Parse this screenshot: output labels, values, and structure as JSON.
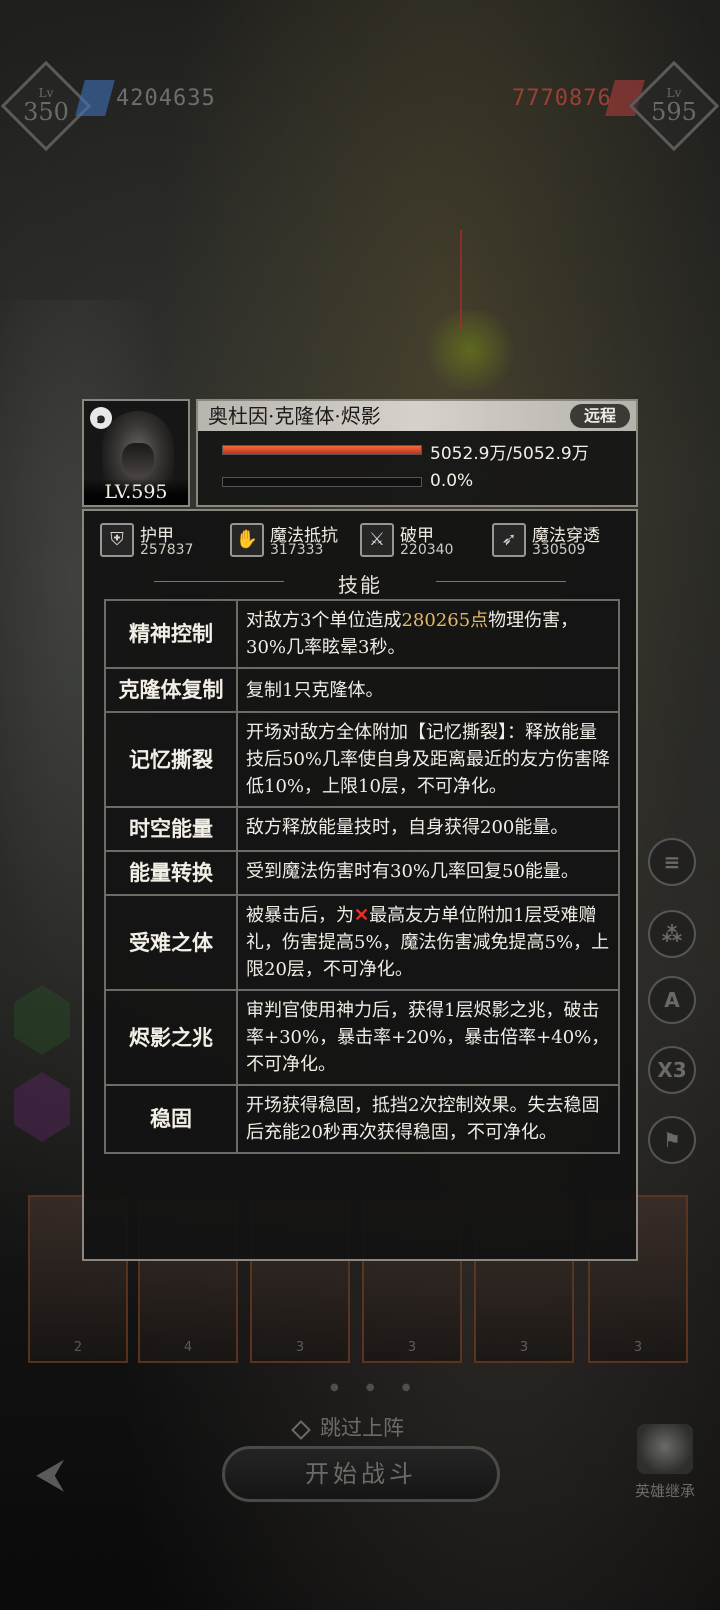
{
  "hud": {
    "left_level_tag": "Lv",
    "left_level": "350",
    "left_power": "4204635",
    "right_power": "7770876",
    "right_level_tag": "Lv",
    "right_level": "595",
    "left_gem_color": "#3e6fb8",
    "right_gem_color": "#b83e3e",
    "right_power_color": "#c0473b",
    "left_power_color": "#6e6e6a"
  },
  "hero": {
    "level": "LV.595",
    "name": "奥杜因·克隆体·烬影",
    "range": "远程",
    "hp_text": "5052.9万/5052.9万",
    "hp_fraction": 1.0,
    "energy_text": "0.0%",
    "energy_fraction": 0.0
  },
  "stats": [
    {
      "icon": "armor-icon",
      "name": "护甲",
      "value": "257837"
    },
    {
      "icon": "magic-resist-icon",
      "name": "魔法抵抗",
      "value": "317333"
    },
    {
      "icon": "armor-break-icon",
      "name": "破甲",
      "value": "220340"
    },
    {
      "icon": "magic-penetration-icon",
      "name": "魔法穿透",
      "value": "330509"
    }
  ],
  "skills_title": "技能",
  "skills": [
    {
      "name": "精神控制",
      "desc_pre": "对敌方3个单位造成",
      "desc_hl": "280265点",
      "desc_post": "物理伤害，30%几率眩晕3秒。"
    },
    {
      "name": "克隆体复制",
      "desc": "复制1只克隆体。"
    },
    {
      "name": "记忆撕裂",
      "desc": "开场对敌方全体附加【记忆撕裂】：释放能量技后50%几率使自身及距离最近的友方伤害降低10%，上限10层，不可净化。"
    },
    {
      "name": "时空能量",
      "desc": "敌方释放能量技时，自身获得200能量。"
    },
    {
      "name": "能量转换",
      "desc": "受到魔法伤害时有30%几率回复50能量。"
    },
    {
      "name": "受难之体",
      "desc_pre": "被暴击后，为",
      "desc_icon": "✕",
      "desc_post": "最高友方单位附加1层受难赠礼，伤害提高5%，魔法伤害减免提高5%，上限20层，不可净化。"
    },
    {
      "name": "烬影之兆",
      "desc": "审判官使用神力后，获得1层烬影之兆，破击率+30%，暴击率+20%，暴击倍率+40%，不可净化。"
    },
    {
      "name": "稳固",
      "desc": "开场获得稳固，抵挡2次控制效果。失去稳固后充能20秒再次获得稳固，不可净化。"
    }
  ],
  "side_buttons": [
    "≡",
    "⁂",
    "A",
    "X3",
    "⚑"
  ],
  "cards": [
    "2",
    "4",
    "3",
    "3",
    "3",
    "3"
  ],
  "bottom": {
    "skip_label": "跳过上阵",
    "start_label": "开始战斗",
    "inherit_label": "英雄继承"
  }
}
